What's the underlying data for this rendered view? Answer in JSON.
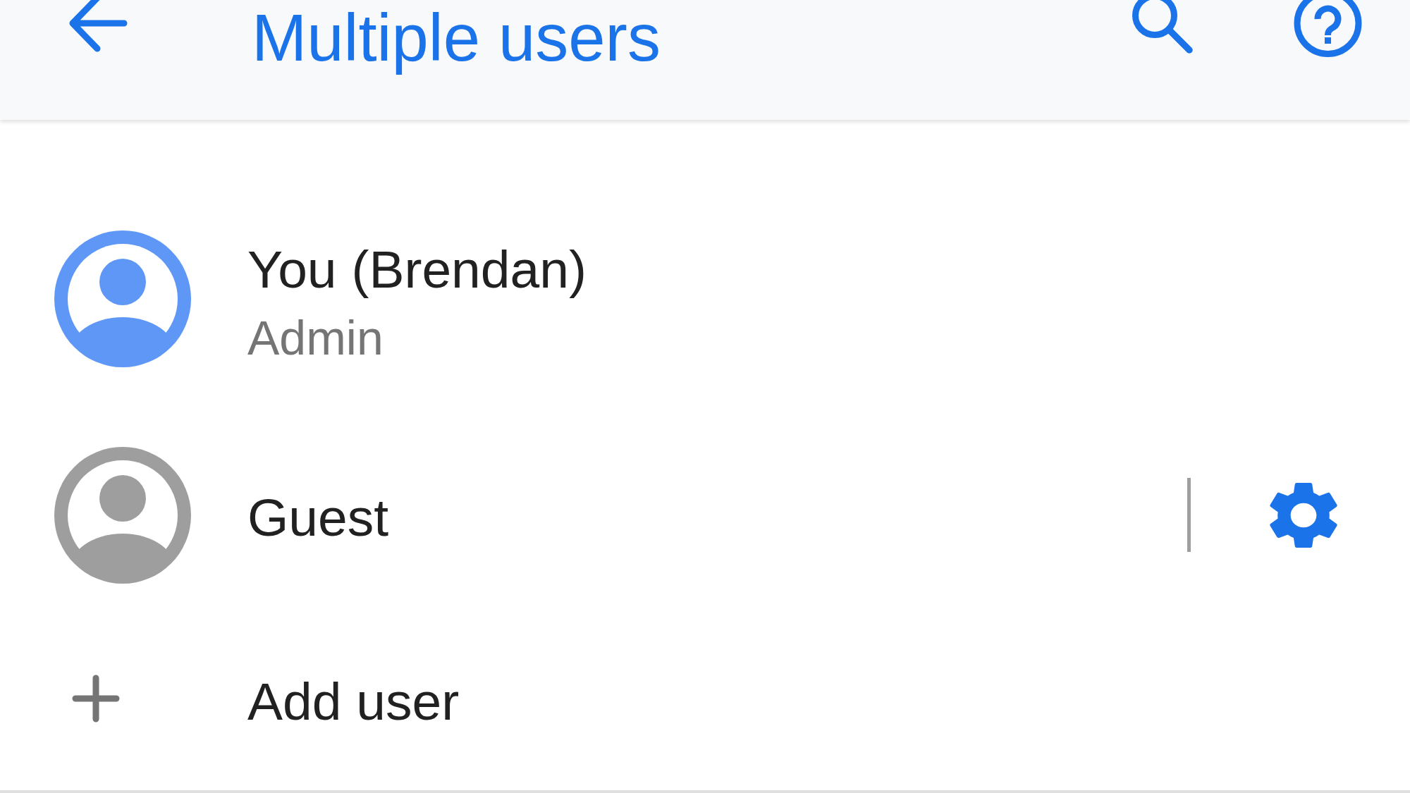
{
  "header": {
    "title": "Multiple users"
  },
  "users": [
    {
      "name": "You (Brendan)",
      "role": "Admin",
      "color": "#5e97f6",
      "settings": false
    },
    {
      "name": "Guest",
      "color": "#9e9e9e",
      "settings": true
    }
  ],
  "add_user": {
    "label": "Add user"
  }
}
